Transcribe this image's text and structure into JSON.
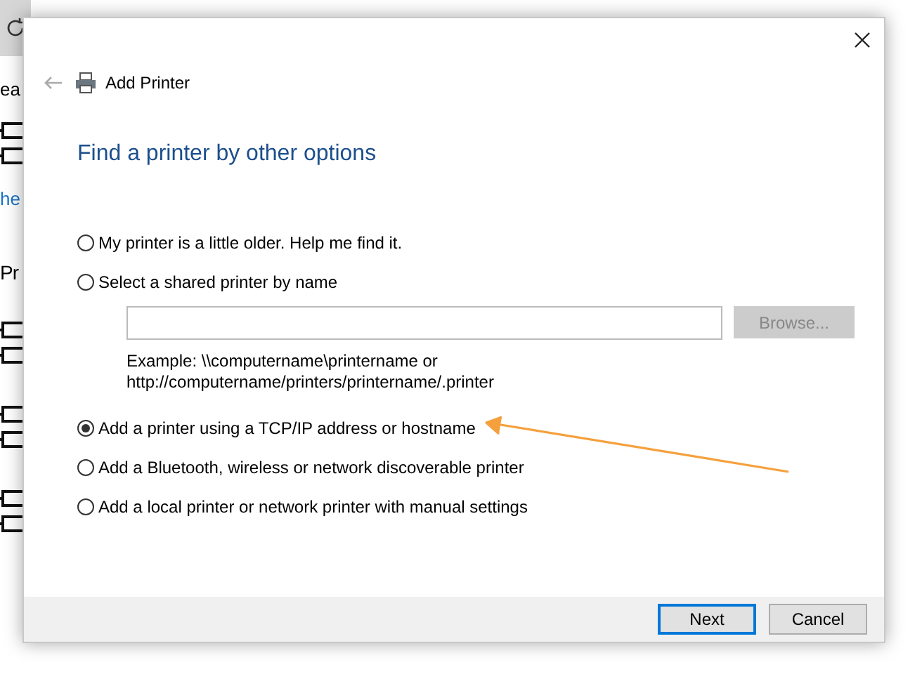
{
  "background": {
    "items": [
      {
        "kind": "text",
        "text": "ea"
      },
      {
        "kind": "device"
      },
      {
        "kind": "link",
        "text": "he"
      },
      {
        "kind": "heading",
        "text": "Pr"
      },
      {
        "kind": "device"
      },
      {
        "kind": "device"
      },
      {
        "kind": "device"
      }
    ]
  },
  "dialog": {
    "title": "Add Printer",
    "heading": "Find a printer by other options",
    "options": [
      {
        "kind": "plain",
        "label": "My printer is a little older. Help me find it.",
        "selected": false
      },
      {
        "kind": "shared",
        "label": "Select a shared printer by name",
        "selected": false,
        "browse_button": "Browse...",
        "browse_disabled": true,
        "example_lines": [
          "Example: \\\\computername\\printername or",
          "http://computername/printers/printername/.printer"
        ]
      },
      {
        "kind": "plain",
        "label": "Add a printer using a TCP/IP address or hostname",
        "selected": true
      },
      {
        "kind": "plain",
        "label": "Add a Bluetooth, wireless or network discoverable printer",
        "selected": false
      },
      {
        "kind": "plain",
        "label": "Add a local printer or network printer with manual settings",
        "selected": false
      }
    ],
    "buttons": [
      {
        "label": "Next",
        "default": true
      },
      {
        "label": "Cancel",
        "default": false
      }
    ]
  }
}
